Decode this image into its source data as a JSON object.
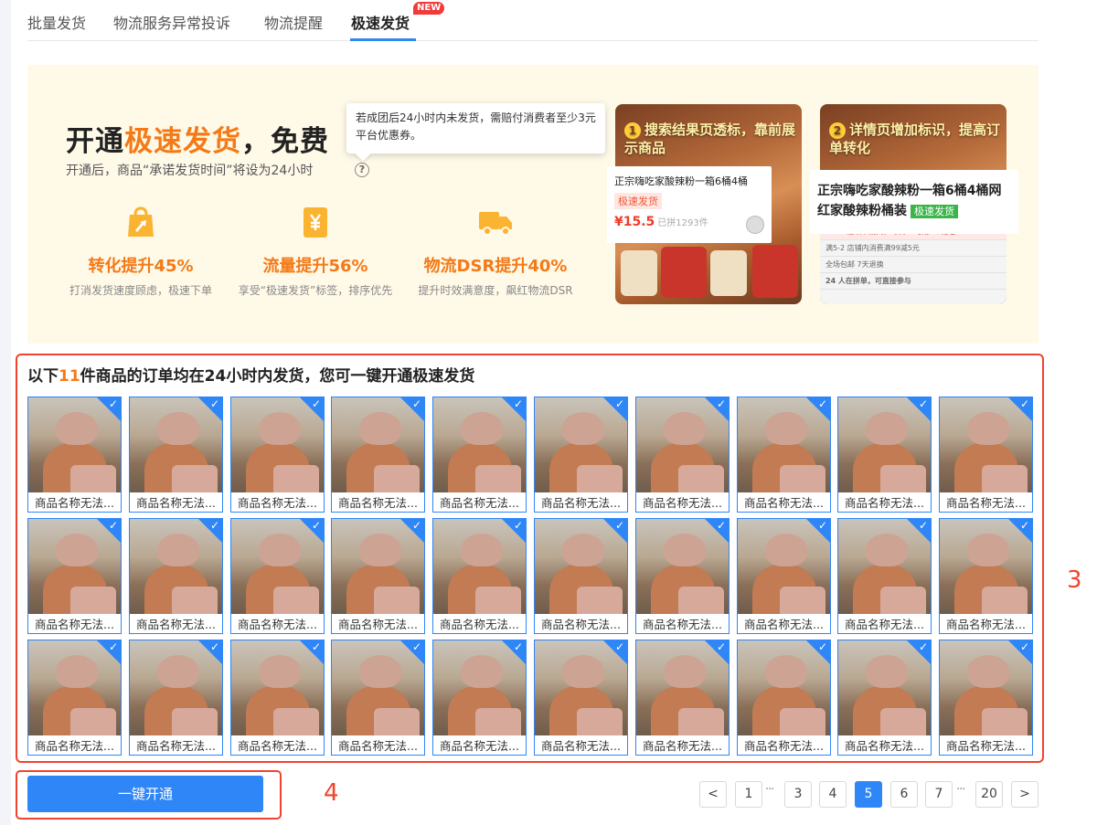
{
  "tabs": [
    {
      "label": "批量发货",
      "active": false
    },
    {
      "label": "物流服务异常投诉",
      "active": false
    },
    {
      "label": "物流提醒",
      "active": false
    },
    {
      "label": "极速发货",
      "active": true
    }
  ],
  "new_badge": "NEW",
  "banner": {
    "title_prefix": "开通",
    "title_highlight": "极速发货",
    "title_suffix": "，免费",
    "subtitle": "开通后，商品“承诺发货时间”将设为24小时",
    "help_icon": "?",
    "tooltip": "若成团后24小时内未发货，需赔付消费者至少3元平台优惠券。",
    "features": [
      {
        "icon": "bag-up-icon",
        "value": "转化提升45%",
        "desc": "打消发货速度顾虑，极速下单"
      },
      {
        "icon": "yen-icon",
        "value": "流量提升56%",
        "desc": "享受“极速发货”标签，排序优先"
      },
      {
        "icon": "truck-icon",
        "value": "物流DSR提升40%",
        "desc": "提升时效满意度，飙红物流DSR"
      }
    ],
    "promos": [
      {
        "num": "1",
        "title": "搜索结果页透标，靠前展示商品",
        "card_title": "正宗嗨吃家酸辣粉一箱6桶4桶",
        "card_tag": "极速发货",
        "card_price": "¥15.5",
        "card_sold": "已拼1293件"
      },
      {
        "num": "2",
        "title": "详情页增加标识，提高订单转化",
        "card_title": "正宗嗨吃家酸辣粉一箱6桶4桶网红家酸辣粉桶装",
        "card_tag": "极速发货",
        "lines": [
          "11-11狂欢节期间，每满50可用5个红包",
          "满5-2 店铺内消费满99减5元",
          "全场包邮   7天退换",
          "24 人在拼单，可直接参与"
        ]
      }
    ]
  },
  "products": {
    "heading_prefix": "以下",
    "heading_count": "11",
    "heading_suffix": "件商品的订单均在24小时内发货，您可一键开通极速发货",
    "items": [
      "商品名称无法...",
      "商品名称无法...",
      "商品名称无法...",
      "商品名称无法...",
      "商品名称无法...",
      "商品名称无法...",
      "商品名称无法...",
      "商品名称无法...",
      "商品名称无法...",
      "商品名称无法...",
      "商品名称无法...",
      "商品名称无法...",
      "商品名称无法...",
      "商品名称无法...",
      "商品名称无法...",
      "商品名称无法...",
      "商品名称无法...",
      "商品名称无法...",
      "商品名称无法...",
      "商品名称无法...",
      "商品名称无法...",
      "商品名称无法...",
      "商品名称无法...",
      "商品名称无法...",
      "商品名称无法...",
      "商品名称无法...",
      "商品名称无法...",
      "商品名称无法...",
      "商品名称无法...",
      "商品名称无法..."
    ],
    "selected": true
  },
  "action_button": "一键开通",
  "annotations": {
    "products": "3",
    "button": "4"
  },
  "pagination": {
    "prev": "<",
    "next": ">",
    "ellipsis": "···",
    "pages": [
      "1",
      "3",
      "4",
      "5",
      "6",
      "7",
      "20"
    ],
    "current": "5"
  },
  "colors": {
    "accent": "#2f86f6",
    "highlight": "#f47a17",
    "annotation": "#f0442e",
    "banner_bg": "#fff9e8"
  }
}
